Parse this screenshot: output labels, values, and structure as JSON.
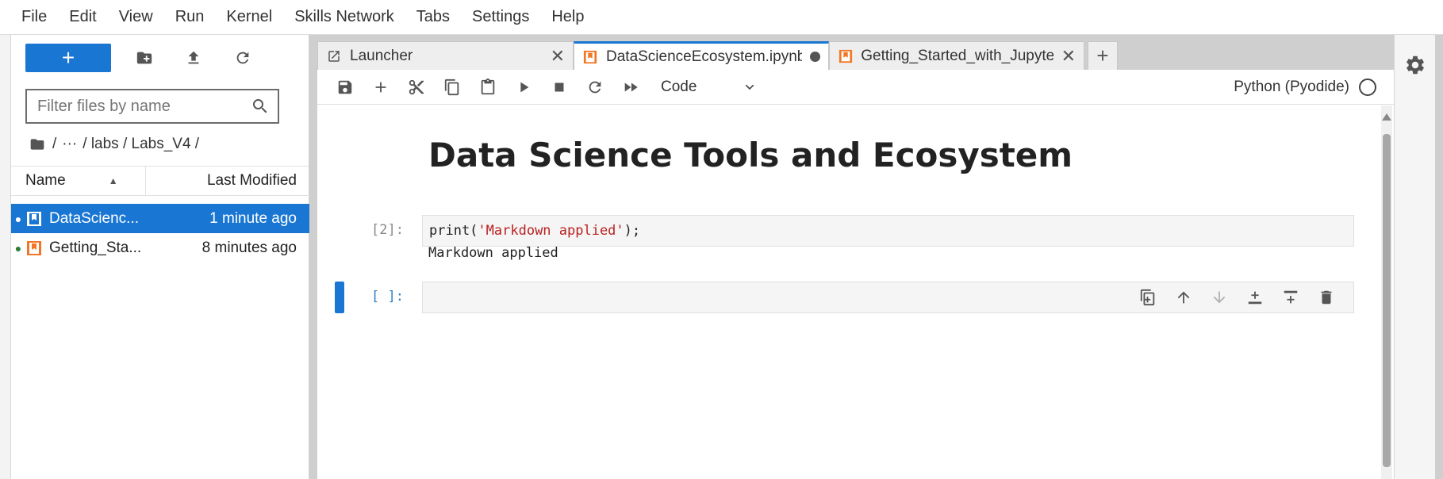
{
  "menu": [
    "File",
    "Edit",
    "View",
    "Run",
    "Kernel",
    "Skills Network",
    "Tabs",
    "Settings",
    "Help"
  ],
  "filebrowser": {
    "new_label": "+",
    "filter_placeholder": "Filter files by name",
    "breadcrumb": [
      "/",
      "···",
      "/ labs / Labs_V4 /"
    ],
    "columns": {
      "name": "Name",
      "modified": "Last Modified"
    },
    "files": [
      {
        "name": "DataScienc...",
        "modified": "1 minute ago",
        "selected": true
      },
      {
        "name": "Getting_Sta...",
        "modified": "8 minutes ago",
        "selected": false
      }
    ]
  },
  "tabs": [
    {
      "label": "Launcher",
      "icon": "launcher-icon"
    },
    {
      "label": "DataScienceEcosystem.ipynb",
      "icon": "notebook-icon",
      "active": true,
      "dirty": true
    },
    {
      "label": "Getting_Started_with_Jupyter",
      "icon": "notebook-icon"
    }
  ],
  "toolbar": {
    "cell_type": "Code",
    "kernel": "Python (Pyodide)"
  },
  "notebook": {
    "heading": "Data Science Tools and Ecosystem",
    "cell1": {
      "prompt": "[2]:",
      "code_prefix": "print(",
      "code_string": "'Markdown applied'",
      "code_suffix": ");",
      "output": "Markdown applied"
    },
    "cell2": {
      "prompt": "[ ]:"
    }
  },
  "colors": {
    "accent": "#1976d2",
    "notebook_orange": "#f37626",
    "string_red": "#ba2121"
  }
}
